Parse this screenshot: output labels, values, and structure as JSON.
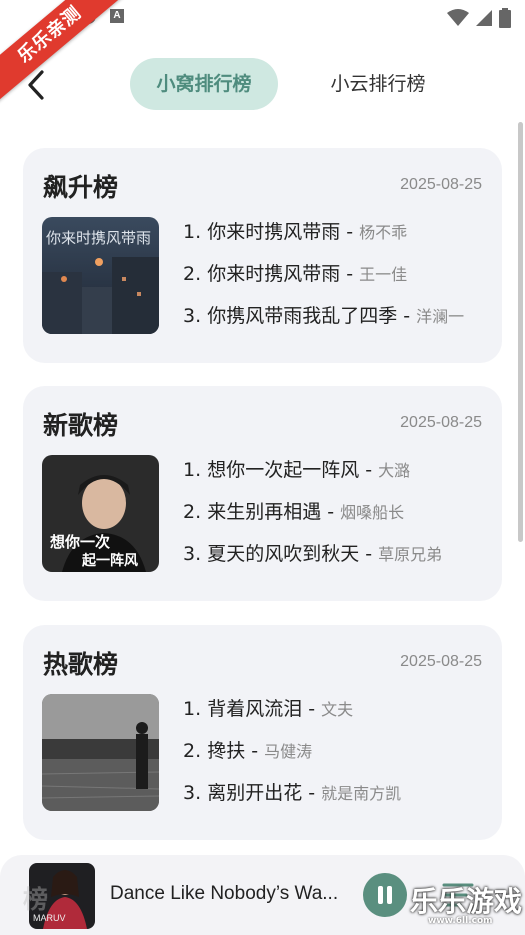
{
  "watermark": {
    "ribbon": "乐乐亲测",
    "logo": "乐乐游戏",
    "url": "www.6ll.com"
  },
  "header": {
    "tabs": [
      {
        "label": "小窝排行榜",
        "active": true
      },
      {
        "label": "小云排行榜",
        "active": false
      }
    ]
  },
  "charts": [
    {
      "title": "飙升榜",
      "date": "2025-08-25",
      "songs": [
        {
          "rank": "1.",
          "name": "你来时携风带雨",
          "artist": "杨不乖"
        },
        {
          "rank": "2.",
          "name": "你来时携风带雨",
          "artist": "王一佳"
        },
        {
          "rank": "3.",
          "name": "你携风带雨我乱了四季",
          "artist": "洋澜一"
        }
      ]
    },
    {
      "title": "新歌榜",
      "date": "2025-08-25",
      "songs": [
        {
          "rank": "1.",
          "name": "想你一次起一阵风",
          "artist": "大潞"
        },
        {
          "rank": "2.",
          "name": "来生别再相遇",
          "artist": "烟嗓船长"
        },
        {
          "rank": "3.",
          "name": "夏天的风吹到秋天",
          "artist": "草原兄弟"
        }
      ]
    },
    {
      "title": "热歌榜",
      "date": "2025-08-25",
      "songs": [
        {
          "rank": "1.",
          "name": "背着风流泪",
          "artist": "文夫"
        },
        {
          "rank": "2.",
          "name": "搀扶",
          "artist": "马健涛"
        },
        {
          "rank": "3.",
          "name": "离别开出花",
          "artist": "就是南方凯"
        }
      ]
    }
  ],
  "next_card_title": "榜",
  "player": {
    "title": "Dance Like Nobody’s Wa..."
  },
  "colors": {
    "accent": "#5a8f7f",
    "tab_active_bg": "#cfe8e1",
    "card_bg": "#f2f3f7"
  }
}
